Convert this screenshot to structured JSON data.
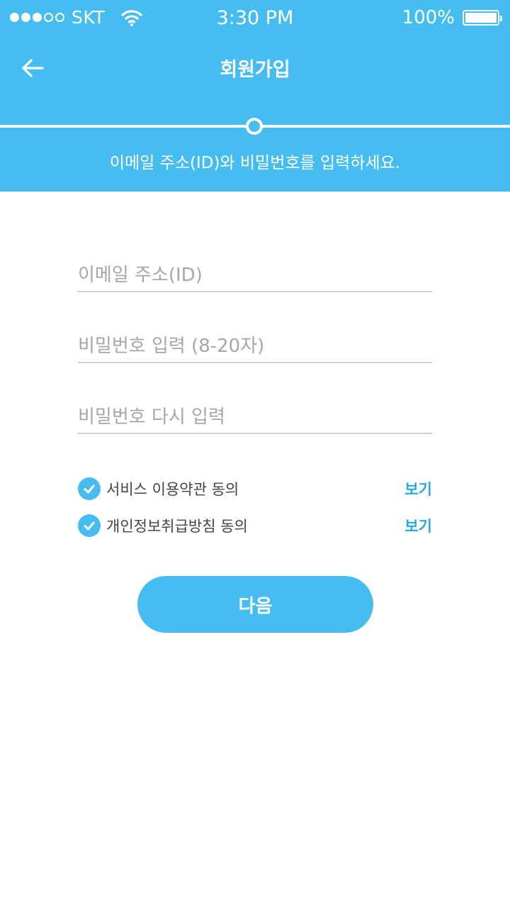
{
  "status_bar": {
    "carrier": "SKT",
    "time": "3:30 PM",
    "battery": "100%",
    "signal_icon": "signal-dots-icon",
    "wifi_icon": "wifi-icon",
    "battery_icon": "battery-icon"
  },
  "header": {
    "back_icon": "arrow-left-icon",
    "title": "회원가입",
    "subtitle": "이메일 주소(ID)와 비밀번호를 입력하세요.",
    "progress_icon": "step-indicator-icon"
  },
  "form": {
    "email_placeholder": "이메일 주소(ID)",
    "email_value": "",
    "password_placeholder": "비밀번호 입력 (8-20자)",
    "password_value": "",
    "password_confirm_placeholder": "비밀번호 다시 입력",
    "password_confirm_value": ""
  },
  "agreements": [
    {
      "label": "서비스 이용약관 동의",
      "link": "보기",
      "checked": true
    },
    {
      "label": "개인정보취급방침 동의",
      "link": "보기",
      "checked": true
    }
  ],
  "next_button": "다음",
  "colors": {
    "primary": "#46bdf0",
    "link": "#2aa9e0",
    "input_underline": "#cfcfcf"
  }
}
